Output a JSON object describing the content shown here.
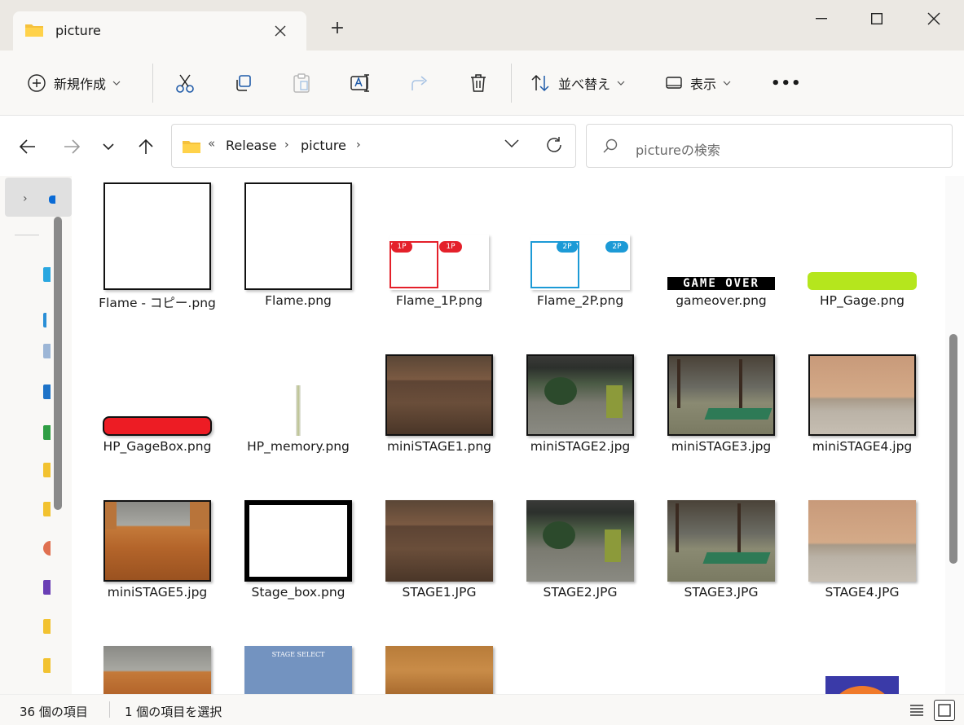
{
  "window": {
    "tab_title": "picture",
    "new_tab": "+"
  },
  "toolbar": {
    "new_label": "新規作成",
    "sort_label": "並べ替え",
    "view_label": "表示",
    "more_label": "•••"
  },
  "address": {
    "overflow": "«",
    "crumbs": [
      "Release",
      "picture"
    ],
    "sep": "›"
  },
  "search": {
    "placeholder": "pictureの検索"
  },
  "files": [
    {
      "name": "Flame - コピー.png"
    },
    {
      "name": "Flame.png"
    },
    {
      "name": "Flame_1P.png",
      "badge": "1P"
    },
    {
      "name": "Flame_2P.png",
      "badge": "2P"
    },
    {
      "name": "gameover.png",
      "text": "GAME OVER"
    },
    {
      "name": "HP_Gage.png"
    },
    {
      "name": "HP_GageBox.png"
    },
    {
      "name": "HP_memory.png"
    },
    {
      "name": "miniSTAGE1.png"
    },
    {
      "name": "miniSTAGE2.jpg"
    },
    {
      "name": "miniSTAGE3.jpg"
    },
    {
      "name": "miniSTAGE4.jpg"
    },
    {
      "name": "miniSTAGE5.jpg"
    },
    {
      "name": "Stage_box.png"
    },
    {
      "name": "STAGE1.JPG"
    },
    {
      "name": "STAGE2.JPG"
    },
    {
      "name": "STAGE3.JPG"
    },
    {
      "name": "STAGE4.JPG"
    },
    {
      "name": "",
      "partial": true
    },
    {
      "name": "",
      "partial": true,
      "text": "STAGE SELECT"
    },
    {
      "name": "",
      "partial": true
    },
    {
      "name": "",
      "partial": true
    }
  ],
  "status": {
    "count": "36 個の項目",
    "selected": "1 個の項目を選択"
  },
  "colors": {
    "red_1p": "#e4202a",
    "blue_2p": "#1c9ad6",
    "hp_green": "#b5e61d",
    "hp_red": "#ed1c24",
    "accent": "#0067c0"
  }
}
